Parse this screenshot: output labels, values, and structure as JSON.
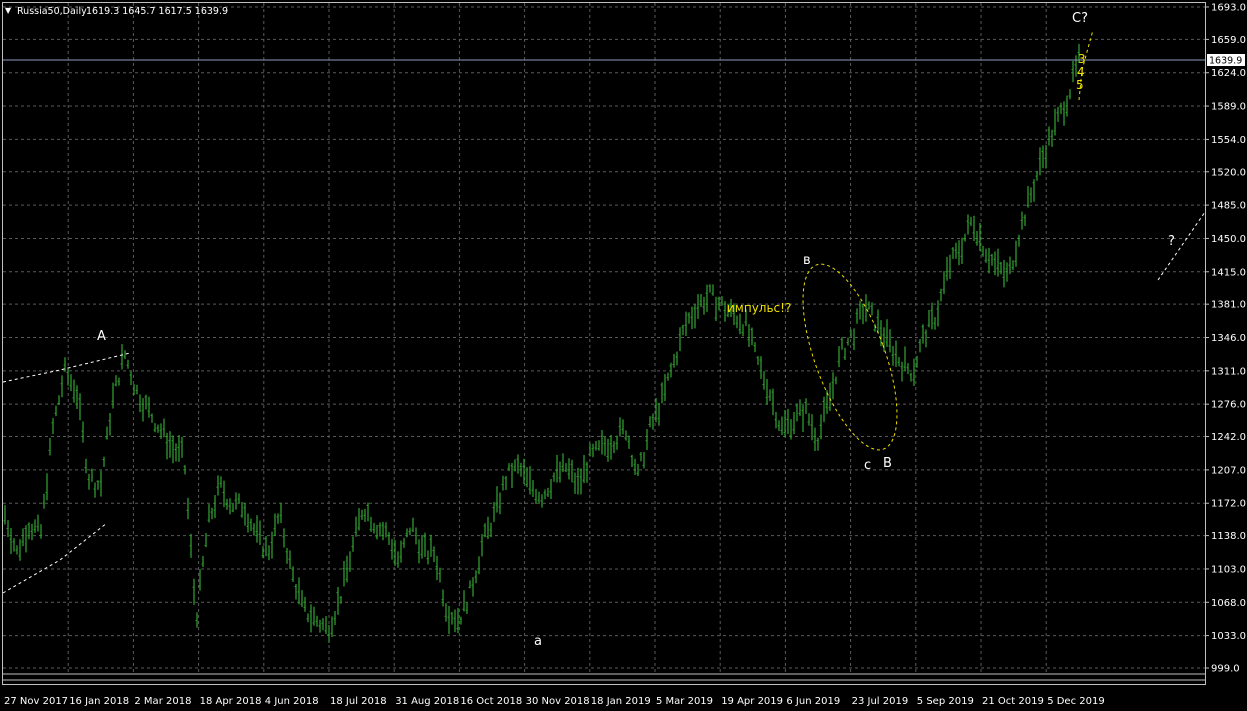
{
  "header": {
    "title": "Russia50,Daily",
    "ohlc": "1619.3 1645.7 1617.5 1639.9"
  },
  "colors": {
    "background": "#000000",
    "grid": "#5a5a5a",
    "candles": "#2e9b2e",
    "axis_text": "#ffffff",
    "annotation_white": "#ffffff",
    "annotation_yellow": "#f0e000",
    "current_price_line": "#8d9bc0"
  },
  "chart_data": {
    "type": "line",
    "title": "Russia50,Daily",
    "ylim": [
      990,
      1700
    ],
    "y_ticks": [
      "1693.0",
      "1659.0",
      "1624.0",
      "1589.0",
      "1554.0",
      "1520.0",
      "1485.0",
      "1450.0",
      "1415.0",
      "1381.0",
      "1346.0",
      "1311.0",
      "1276.0",
      "1242.0",
      "1207.0",
      "1172.0",
      "1138.0",
      "1103.0",
      "1068.0",
      "1033.0",
      "999.0"
    ],
    "x_ticks": [
      "27 Nov 2017",
      "16 Jan 2018",
      "2 Mar 2018",
      "18 Apr 2018",
      "4 Jun 2018",
      "18 Jul 2018",
      "31 Aug 2018",
      "16 Oct 2018",
      "30 Nov 2018",
      "18 Jan 2019",
      "5 Mar 2019",
      "19 Apr 2019",
      "6 Jun 2019",
      "23 Jul 2019",
      "5 Sep 2019",
      "21 Oct 2019",
      "5 Dec 2019"
    ],
    "current_price": "1639.9",
    "series": [
      {
        "x": [
          "27 Nov 2017",
          "8 Dec 2017",
          "20 Dec 2017",
          "10 Jan 2018",
          "16 Jan 2018",
          "25 Jan 2018",
          "5 Feb 2018",
          "9 Feb 2018",
          "14 Feb 2018",
          "20 Feb 2018",
          "2 Mar 2018",
          "12 Mar 2018",
          "26 Mar 2018",
          "4 Apr 2018",
          "9 Apr 2018",
          "16 Apr 2018",
          "18 Apr 2018",
          "30 Apr 2018",
          "15 May 2018",
          "28 May 2018",
          "4 Jun 2018",
          "15 Jun 2018",
          "25 Jun 2018",
          "5 Jul 2018",
          "18 Jul 2018",
          "27 Jul 2018",
          "8 Aug 2018",
          "16 Aug 2018",
          "24 Aug 2018",
          "31 Aug 2018",
          "12 Sep 2018",
          "25 Sep 2018",
          "5 Oct 2018",
          "16 Oct 2018",
          "26 Oct 2018",
          "6 Nov 2018",
          "15 Nov 2018",
          "24 Nov 2018",
          "30 Nov 2018",
          "5 Dec 2018",
          "17 Dec 2018",
          "28 Dec 2018",
          "10 Jan 2019",
          "18 Jan 2019",
          "29 Jan 2019",
          "7 Feb 2019",
          "18 Feb 2019",
          "27 Feb 2019",
          "5 Mar 2019",
          "15 Mar 2019",
          "26 Mar 2019",
          "3 Apr 2019",
          "12 Apr 2019",
          "19 Apr 2019",
          "26 Apr 2019",
          "8 May 2019",
          "16 May 2019",
          "27 May 2019",
          "6 Jun 2019",
          "13 Jun 2019",
          "20 Jun 2019",
          "28 Jun 2019",
          "5 Jul 2019",
          "12 Jul 2019",
          "18 Jul 2019",
          "23 Jul 2019",
          "29 Jul 2019",
          "5 Aug 2019",
          "12 Aug 2019",
          "16 Aug 2019",
          "23 Aug 2019",
          "30 Aug 2019",
          "5 Sep 2019",
          "12 Sep 2019",
          "19 Sep 2019",
          "27 Sep 2019",
          "4 Oct 2019",
          "11 Oct 2019",
          "16 Oct 2019",
          "21 Oct 2019",
          "25 Oct 2019",
          "1 Nov 2019",
          "8 Nov 2019",
          "15 Nov 2019",
          "20 Nov 2019",
          "27 Nov 2019",
          "5 Dec 2019",
          "12 Dec 2019",
          "19 Dec 2019",
          "25 Dec 2019",
          "30 Dec 2019"
        ],
        "values": [
          1160,
          1120,
          1150,
          1140,
          1250,
          1310,
          1290,
          1200,
          1190,
          1280,
          1330,
          1290,
          1270,
          1250,
          1230,
          1220,
          1050,
          1150,
          1190,
          1170,
          1170,
          1140,
          1120,
          1160,
          1100,
          1060,
          1050,
          1040,
          1070,
          1120,
          1170,
          1150,
          1140,
          1110,
          1150,
          1120,
          1120,
          1060,
          1050,
          1080,
          1130,
          1160,
          1200,
          1210,
          1190,
          1180,
          1200,
          1210,
          1190,
          1220,
          1230,
          1240,
          1250,
          1200,
          1250,
          1280,
          1320,
          1360,
          1380,
          1390,
          1380,
          1370,
          1360,
          1320,
          1290,
          1250,
          1260,
          1270,
          1240,
          1280,
          1330,
          1350,
          1380,
          1360,
          1340,
          1320,
          1310,
          1350,
          1370,
          1420,
          1440,
          1470,
          1440,
          1420,
          1410,
          1460,
          1500,
          1540,
          1570,
          1600,
          1640
        ]
      }
    ]
  },
  "annotations": {
    "label_A": "A",
    "label_a": "a",
    "label_v": "в",
    "label_c": "c",
    "label_B": "B",
    "label_C": "C?",
    "label_q": "?",
    "label_impulse": "импульс!?",
    "label_3": "3",
    "label_4": "4",
    "label_5": "5"
  }
}
